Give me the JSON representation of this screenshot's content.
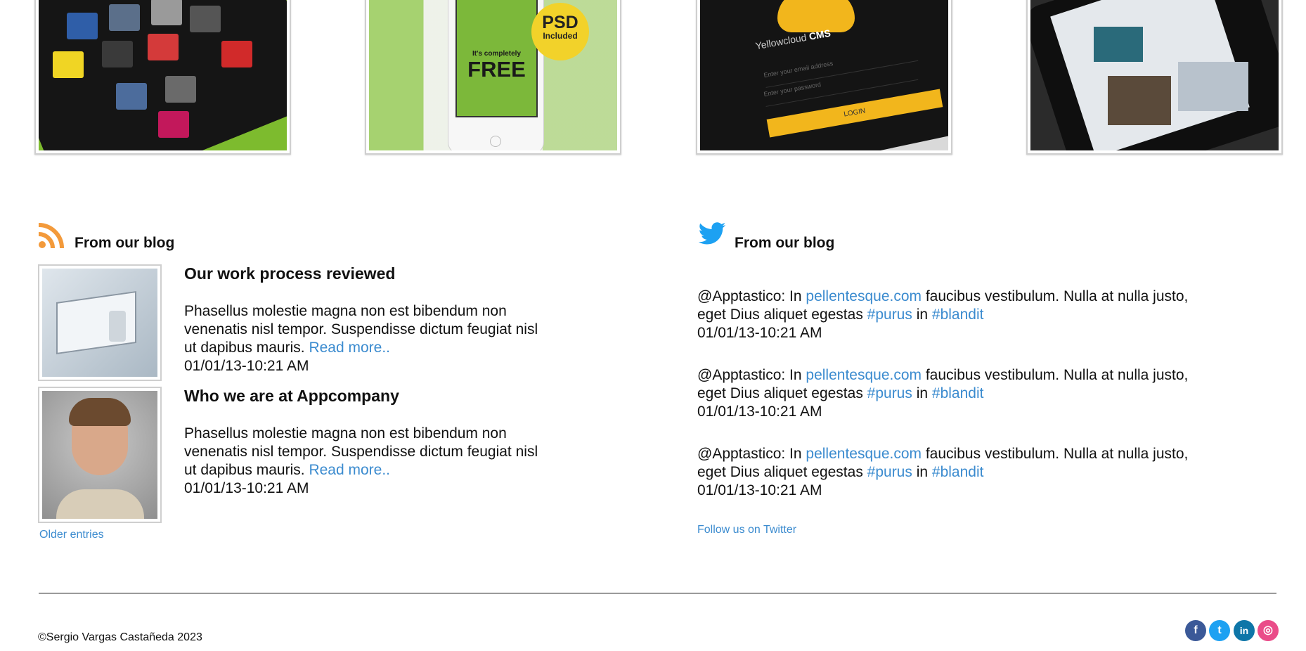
{
  "portfolio": {
    "items": [
      {
        "name": "music-app"
      },
      {
        "name": "free-psd-phone",
        "free_small": "It's completely",
        "free_big": "FREE",
        "badge_top": "PSD",
        "badge_bottom": "Included"
      },
      {
        "name": "yellowcloud-cms",
        "cms_text": "Yellowcloud",
        "cms_bold": "CMS",
        "field1": "Enter your email address",
        "field2": "Enter your password",
        "login": "LOGIN"
      },
      {
        "name": "social-app"
      }
    ]
  },
  "blog": {
    "title": "From our blog",
    "posts": [
      {
        "title": "Our work process reviewed",
        "body": "Phasellus molestie magna non est bibendum non venenatis nisl tempor. Suspendisse dictum feugiat nisl ut dapibus mauris.",
        "read_more": "Read more..",
        "date": "01/01/13-10:21 AM"
      },
      {
        "title": "Who we are at Appcompany",
        "body": "Phasellus molestie magna non est bibendum non venenatis nisl tempor. Suspendisse dictum feugiat nisl ut dapibus mauris.",
        "read_more": "Read more..",
        "date": "01/01/13-10:21 AM"
      }
    ],
    "older_entries": "Older entries"
  },
  "twitter": {
    "title": "From our blog",
    "tweets": [
      {
        "handle": "@Apptastico: In ",
        "link": "pellentesque.com",
        "mid": " faucibus vestibulum. Nulla at nulla justo, eget Dius aliquet egestas ",
        "tag1": "#purus",
        "in": " in ",
        "tag2": "#blandit",
        "date": "01/01/13-10:21 AM"
      },
      {
        "handle": "@Apptastico: In ",
        "link": "pellentesque.com",
        "mid": " faucibus vestibulum. Nulla at nulla justo, eget Dius aliquet egestas ",
        "tag1": "#purus",
        "in": " in ",
        "tag2": "#blandit",
        "date": "01/01/13-10:21 AM"
      },
      {
        "handle": "@Apptastico: In ",
        "link": "pellentesque.com",
        "mid": " faucibus vestibulum. Nulla at nulla justo, eget Dius aliquet egestas ",
        "tag1": "#purus",
        "in": " in ",
        "tag2": "#blandit",
        "date": "01/01/13-10:21 AM"
      }
    ],
    "follow": "Follow us on Twitter"
  },
  "footer": {
    "copyright": "©Sergio Vargas Castañeda 2023",
    "social": [
      {
        "icon": "facebook-icon",
        "glyph": "f"
      },
      {
        "icon": "twitter-icon",
        "glyph": "t"
      },
      {
        "icon": "linkedin-icon",
        "glyph": "in"
      },
      {
        "icon": "dribbble-icon",
        "glyph": "◎"
      }
    ]
  },
  "colors": {
    "link": "#3b8bcf",
    "rss": "#f39a3b",
    "twitter": "#1da1f2"
  }
}
